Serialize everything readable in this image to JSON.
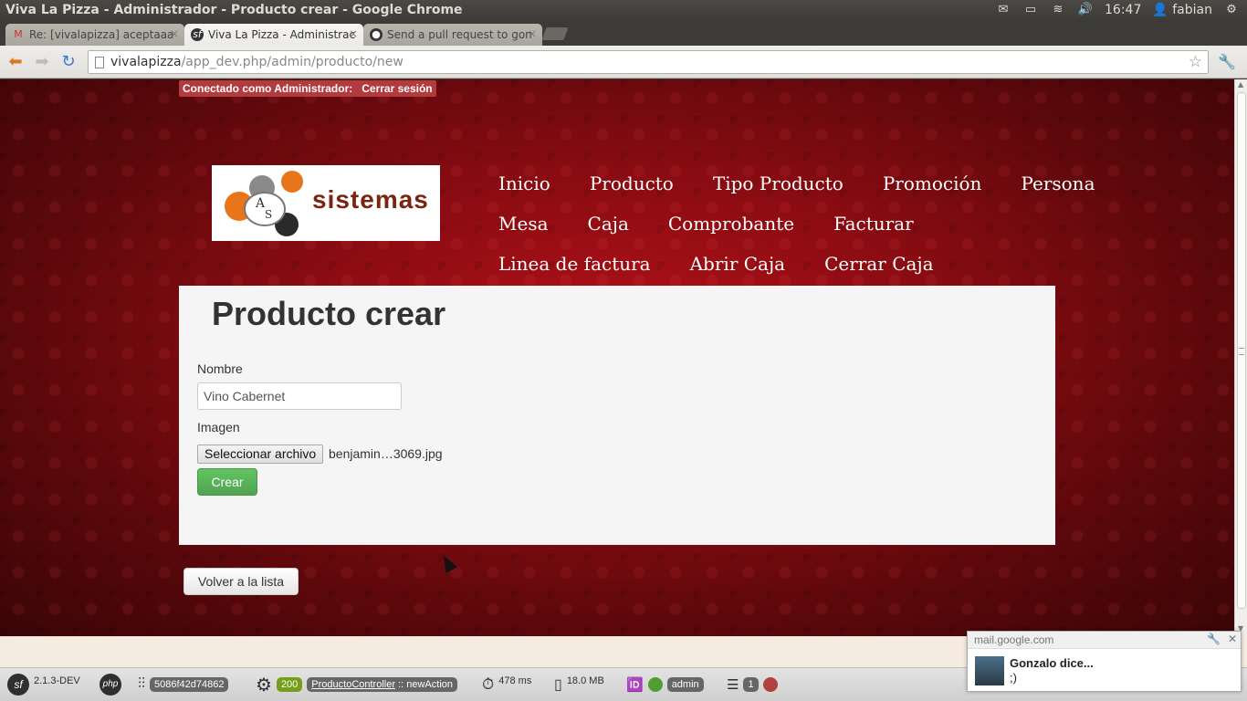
{
  "os": {
    "window_title": "Viva La Pizza - Administrador - Producto crear - Google Chrome",
    "clock": "16:47",
    "user": "fabian",
    "icons": [
      "mail-icon",
      "battery-icon",
      "wifi-icon",
      "volume-icon",
      "user-icon",
      "gear-icon"
    ]
  },
  "browser": {
    "tabs": [
      {
        "title": "Re: [vivalapizza] aceptaaa",
        "favicon": "gmail-icon",
        "active": false
      },
      {
        "title": "Viva La Pizza - Administrac",
        "favicon": "symfony-icon",
        "active": true
      },
      {
        "title": "Send a pull request to gon",
        "favicon": "github-icon",
        "active": false
      }
    ],
    "url_host": "vivalapizza",
    "url_path": "/app_dev.php/admin/producto/new"
  },
  "page": {
    "login_label": "Conectado como Administrador:",
    "logout_label": "Cerrar sesión",
    "logo_text": "sistemas",
    "nav": [
      [
        "Inicio",
        "Producto",
        "Tipo Producto",
        "Promoción",
        "Persona"
      ],
      [
        "Mesa",
        "Caja",
        "Comprobante",
        "Facturar"
      ],
      [
        "Linea de factura",
        "Abrir Caja",
        "Cerrar Caja"
      ]
    ],
    "heading": "Producto crear",
    "form": {
      "nombre_label": "Nombre",
      "nombre_value": "Vino Cabernet",
      "imagen_label": "Imagen",
      "file_button": "Seleccionar archivo",
      "file_name": "benjamin…3069.jpg",
      "submit_label": "Crear"
    },
    "back_label": "Volver a la lista"
  },
  "symfony_toolbar": {
    "version": "2.1.3-DEV",
    "token": "5086f42d74862",
    "status": "200",
    "controller": "ProductoController",
    "action": "newAction",
    "time": "478 ms",
    "memory": "18.0 MB",
    "user": "admin",
    "queries": "1",
    "colors": {
      "status_green": "#759e1a",
      "user_green": "#4f9e31",
      "error_red": "#b0413e"
    }
  },
  "notification": {
    "source": "mail.google.com",
    "title": "Gonzalo dice...",
    "body": ";)"
  }
}
